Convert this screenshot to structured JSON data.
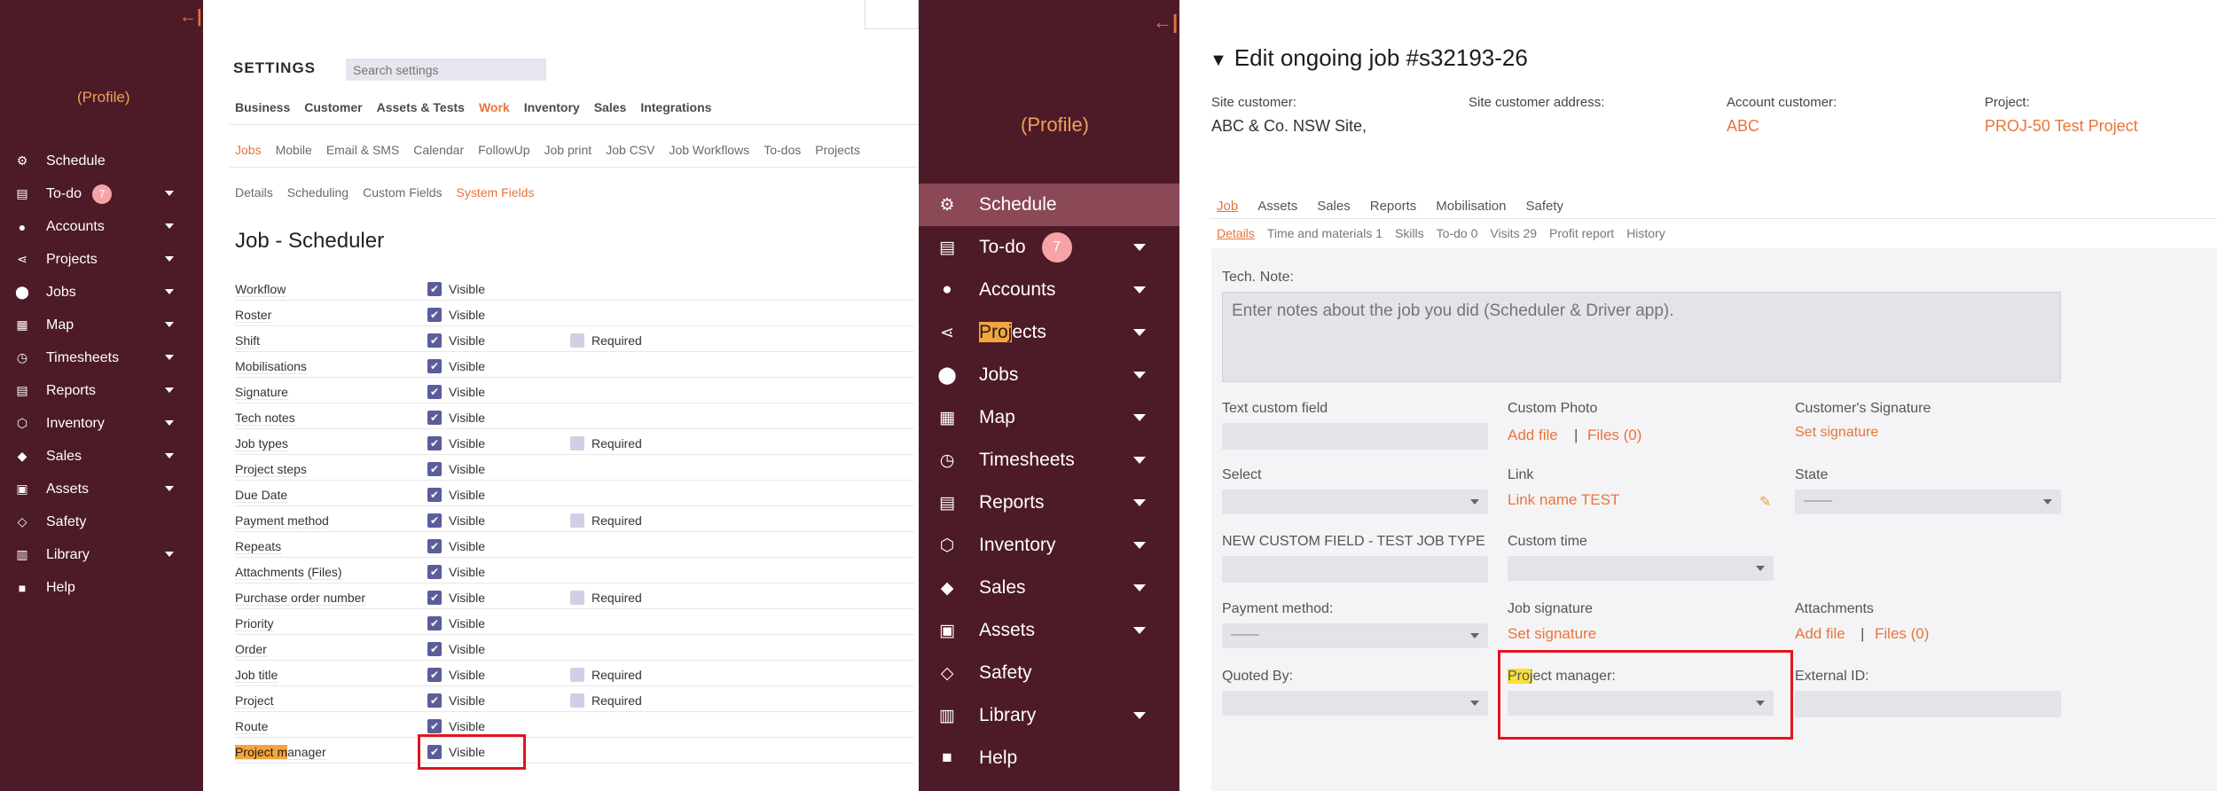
{
  "sidebar_left": {
    "collapse": "←|",
    "profile": "(Profile)",
    "items": [
      {
        "label": "Schedule",
        "icon": "schedule-icon",
        "glyph": "⚙",
        "caret": false
      },
      {
        "label": "To-do",
        "icon": "todo-icon",
        "glyph": "▤",
        "caret": true,
        "badge": "7"
      },
      {
        "label": "Accounts",
        "icon": "person-icon",
        "glyph": "●",
        "caret": true
      },
      {
        "label": "Projects",
        "icon": "projects-icon",
        "glyph": "⋖",
        "caret": true
      },
      {
        "label": "Jobs",
        "icon": "location-pin-icon",
        "glyph": "⬤",
        "caret": true
      },
      {
        "label": "Map",
        "icon": "map-icon",
        "glyph": "▦",
        "caret": true
      },
      {
        "label": "Timesheets",
        "icon": "clock-icon",
        "glyph": "◷",
        "caret": true
      },
      {
        "label": "Reports",
        "icon": "reports-icon",
        "glyph": "▤",
        "caret": true
      },
      {
        "label": "Inventory",
        "icon": "cube-icon",
        "glyph": "⬡",
        "caret": true
      },
      {
        "label": "Sales",
        "icon": "tag-icon",
        "glyph": "◆",
        "caret": true
      },
      {
        "label": "Assets",
        "icon": "assets-icon",
        "glyph": "▣",
        "caret": true
      },
      {
        "label": "Safety",
        "icon": "shield-icon",
        "glyph": "◇",
        "caret": false
      },
      {
        "label": "Library",
        "icon": "book-icon",
        "glyph": "▥",
        "caret": true
      },
      {
        "label": "Help",
        "icon": "help-icon",
        "glyph": "■",
        "caret": false
      }
    ]
  },
  "settings": {
    "title": "SETTINGS",
    "search_placeholder": "Search settings",
    "top_tabs": [
      "Business",
      "Customer",
      "Assets & Tests",
      "Work",
      "Inventory",
      "Sales",
      "Integrations"
    ],
    "top_active": "Work",
    "sub_tabs": [
      "Jobs",
      "Mobile",
      "Email & SMS",
      "Calendar",
      "FollowUp",
      "Job print",
      "Job CSV",
      "Job Workflows",
      "To-dos",
      "Projects"
    ],
    "sub_active": "Jobs",
    "third_tabs": [
      "Details",
      "Scheduling",
      "Custom Fields",
      "System Fields"
    ],
    "third_active": "System Fields",
    "heading": "Job - Scheduler",
    "visible_label": "Visible",
    "required_label": "Required",
    "fields": [
      {
        "name": "Workflow",
        "required": false
      },
      {
        "name": "Roster",
        "required": false
      },
      {
        "name": "Shift",
        "required": true
      },
      {
        "name": "Mobilisations",
        "required": false
      },
      {
        "name": "Signature",
        "required": false
      },
      {
        "name": "Tech notes",
        "required": false
      },
      {
        "name": "Job types",
        "required": true
      },
      {
        "name": "Project steps",
        "required": false
      },
      {
        "name": "Due Date",
        "required": false
      },
      {
        "name": "Payment method",
        "required": true
      },
      {
        "name": "Repeats",
        "required": false
      },
      {
        "name": "Attachments (Files)",
        "required": false
      },
      {
        "name": "Purchase order number",
        "required": true
      },
      {
        "name": "Priority",
        "required": false
      },
      {
        "name": "Order",
        "required": false
      },
      {
        "name": "Job title",
        "required": true
      },
      {
        "name": "Project",
        "required": true
      },
      {
        "name": "Route",
        "required": false
      },
      {
        "name": "Project manager",
        "required": false,
        "highlight": "Project m"
      }
    ]
  },
  "sidebar_right": {
    "collapse": "←|",
    "profile": "(Profile)",
    "active": "Schedule"
  },
  "job": {
    "title": "Edit ongoing job #s32193-26",
    "meta": [
      {
        "label": "Site customer:",
        "value": "ABC & Co. NSW Site,",
        "link": false
      },
      {
        "label": "Site customer address:",
        "value": "",
        "link": false
      },
      {
        "label": "Account customer:",
        "value": "ABC",
        "link": true
      },
      {
        "label": "Project:",
        "value": "PROJ-50 Test Project",
        "link": true
      }
    ],
    "tabs": [
      "Job",
      "Assets",
      "Sales",
      "Reports",
      "Mobilisation",
      "Safety"
    ],
    "tabs_active": "Job",
    "subtabs": [
      "Details",
      "Time and materials 1",
      "Skills",
      "To-do 0",
      "Visits 29",
      "Profit report",
      "History"
    ],
    "subtabs_active": "Details",
    "tech_note_label": "Tech. Note:",
    "tech_note_placeholder": "Enter notes about the job you did (Scheduler & Driver app).",
    "text_custom_field": "Text custom field",
    "custom_photo": "Custom Photo",
    "add_file": "Add file",
    "separator": "|",
    "files0": "Files (0)",
    "customers_signature": "Customer's Signature",
    "set_signature": "Set signature",
    "select_label": "Select",
    "link_label": "Link",
    "link_name": "Link name TEST",
    "state_label": "State",
    "dash": "——",
    "new_custom_field": "NEW CUSTOM FIELD - TEST JOB TYPE",
    "custom_time": "Custom time",
    "payment_method": "Payment method:",
    "job_signature": "Job signature",
    "attachments": "Attachments",
    "quoted_by": "Quoted By:",
    "project_manager_hl": "Proj",
    "project_manager_rest": "ect manager:",
    "external_id": "External ID:"
  }
}
